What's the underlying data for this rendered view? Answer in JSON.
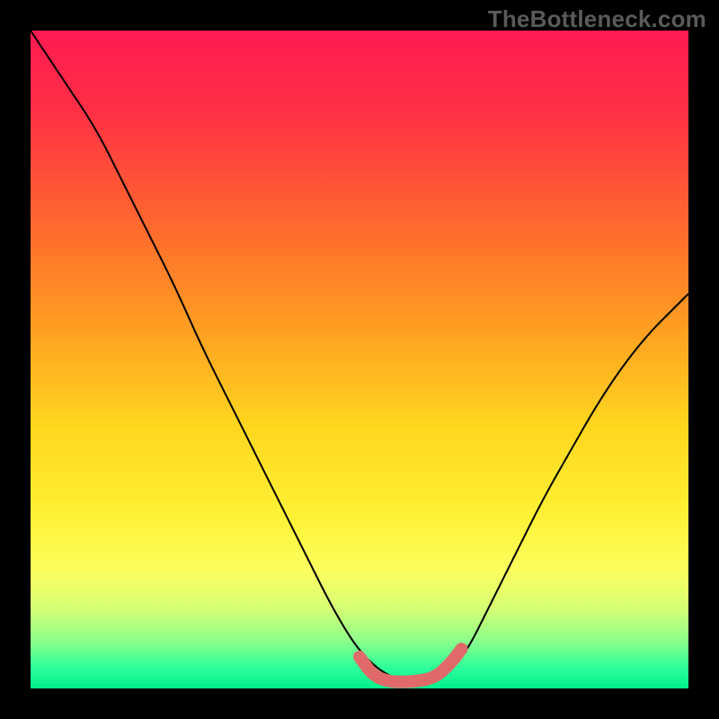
{
  "watermark": "TheBottleneck.com",
  "chart_data": {
    "type": "line",
    "title": "",
    "xlabel": "",
    "ylabel": "",
    "xlim": [
      0,
      1
    ],
    "ylim": [
      0,
      1
    ],
    "grid": false,
    "legend": false,
    "gradient_background": {
      "stops": [
        {
          "offset": 0.0,
          "color": "#ff1a52"
        },
        {
          "offset": 0.12,
          "color": "#ff2f45"
        },
        {
          "offset": 0.3,
          "color": "#ff6a2d"
        },
        {
          "offset": 0.45,
          "color": "#ff9e22"
        },
        {
          "offset": 0.6,
          "color": "#ffd61e"
        },
        {
          "offset": 0.74,
          "color": "#fff236"
        },
        {
          "offset": 0.82,
          "color": "#fbff5e"
        },
        {
          "offset": 0.88,
          "color": "#d4ff75"
        },
        {
          "offset": 0.93,
          "color": "#88ff8c"
        },
        {
          "offset": 0.97,
          "color": "#2bff9a"
        },
        {
          "offset": 1.0,
          "color": "#00ef8c"
        }
      ]
    },
    "series": [
      {
        "name": "bottleneck-curve",
        "color": "#000000",
        "stroke_width": 2,
        "x": [
          0.0,
          0.06,
          0.1,
          0.14,
          0.18,
          0.22,
          0.26,
          0.3,
          0.34,
          0.38,
          0.42,
          0.46,
          0.5,
          0.54,
          0.58,
          0.62,
          0.66,
          0.7,
          0.74,
          0.78,
          0.82,
          0.86,
          0.9,
          0.94,
          0.98,
          1.0
        ],
        "y": [
          1.0,
          0.91,
          0.85,
          0.77,
          0.69,
          0.61,
          0.52,
          0.44,
          0.36,
          0.28,
          0.2,
          0.12,
          0.055,
          0.02,
          0.008,
          0.01,
          0.05,
          0.13,
          0.21,
          0.29,
          0.36,
          0.43,
          0.49,
          0.54,
          0.58,
          0.6
        ]
      },
      {
        "name": "highlight-band",
        "color": "#e06a6a",
        "stroke_width": 14,
        "linecap": "round",
        "x": [
          0.5,
          0.52,
          0.545,
          0.58,
          0.615,
          0.64,
          0.655
        ],
        "y": [
          0.048,
          0.02,
          0.01,
          0.01,
          0.016,
          0.04,
          0.06
        ]
      }
    ]
  }
}
